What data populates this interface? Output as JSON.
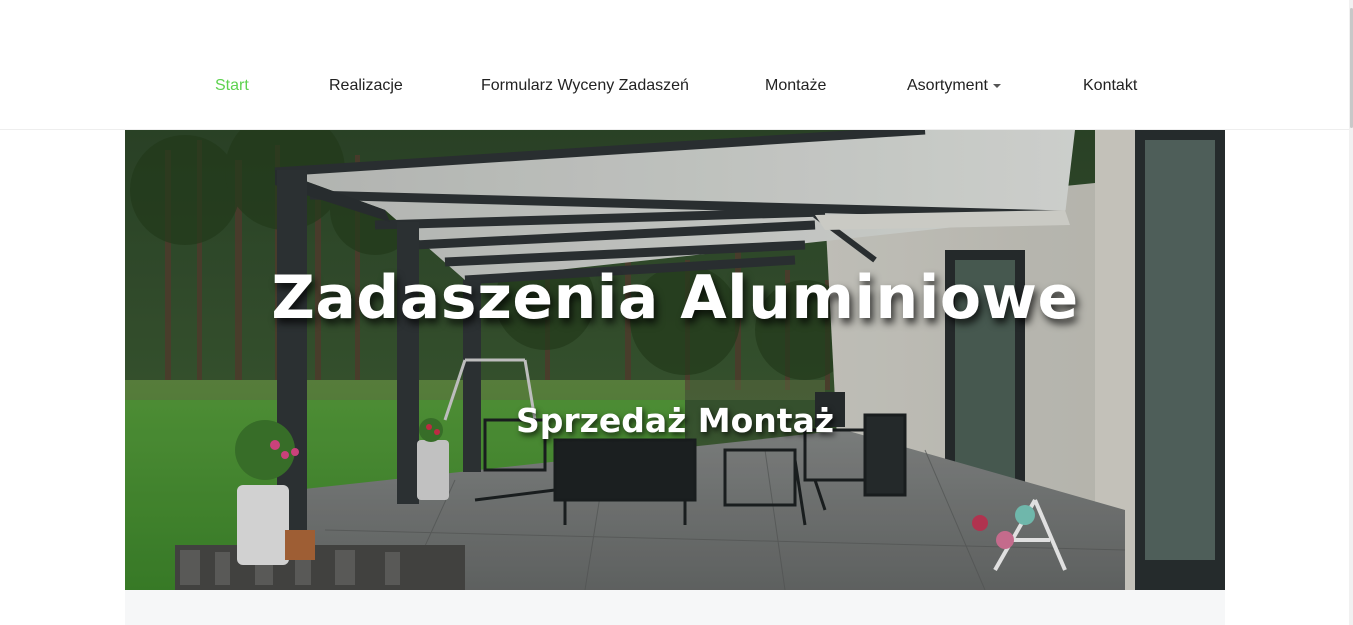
{
  "nav": {
    "items": [
      {
        "label": "Start",
        "active": true
      },
      {
        "label": "Realizacje"
      },
      {
        "label": "Formularz Wyceny Zadaszeń"
      },
      {
        "label": "Montaże"
      },
      {
        "label": "Asortyment",
        "has_dropdown": true
      },
      {
        "label": "Kontakt"
      }
    ],
    "dropdown_icon": "caret-down-icon"
  },
  "hero": {
    "title": "Zadaszenia Aluminiowe",
    "subtitle": "Sprzedaż Montaż",
    "image": "aluminium-pergola-terrace-photo"
  },
  "colors": {
    "accent": "#5ed24f",
    "nav_text": "#222222",
    "hero_text": "#ffffff",
    "band": "#f6f7f8"
  }
}
